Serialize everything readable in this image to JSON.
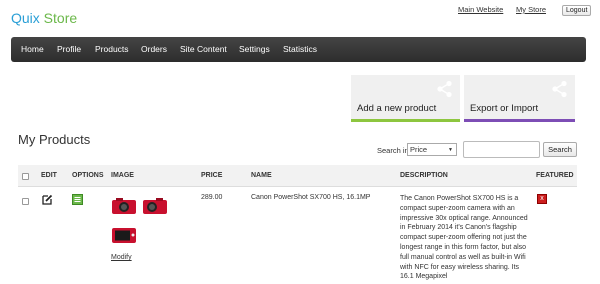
{
  "brand": {
    "part1": "Quix",
    "part2": " Store"
  },
  "top_links": {
    "main_website": "Main Website",
    "my_store": "My Store",
    "logout": "Logout"
  },
  "nav": [
    "Home",
    "Profile",
    "Products",
    "Orders",
    "Site Content",
    "Settings",
    "Statistics"
  ],
  "tiles": {
    "add": "Add a new product",
    "export": "Export or Import"
  },
  "page_title": "My Products",
  "search": {
    "label": "Search in",
    "field": "Price",
    "value": "",
    "button": "Search"
  },
  "table": {
    "headers": {
      "edit": "EDIT",
      "options": "OPTIONS",
      "image": "IMAGE",
      "price": "PRICE",
      "name": "NAME",
      "description": "DESCRIPTION",
      "featured": "FEATURED"
    },
    "rows": [
      {
        "price": "289.00",
        "name": "Canon PowerShot SX700 HS, 16.1MP",
        "description": "The Canon PowerShot SX700 HS is a compact super-zoom camera with an impressive 30x optical range. Announced in February 2014 it's Canon's flagship compact super-zoom offering not just the longest range in this form factor, but also full manual control as well as built-in Wifi with NFC for easy wireless sharing. Its 16.1 Megapixel",
        "modify": "Modify",
        "featured": "x"
      }
    ]
  },
  "colors": {
    "brand_blue": "#2a9fd6",
    "brand_green": "#6bb84a",
    "tile_add_accent": "#8dc63f",
    "tile_export_accent": "#7d4db5",
    "nav_bg": "#333333",
    "camera_red": "#c8102e",
    "featured_red": "#cc1f1f"
  },
  "icons": {
    "tile": "share-icon",
    "edit": "edit-icon",
    "options": "options-icon",
    "featured": "featured-x-icon"
  }
}
